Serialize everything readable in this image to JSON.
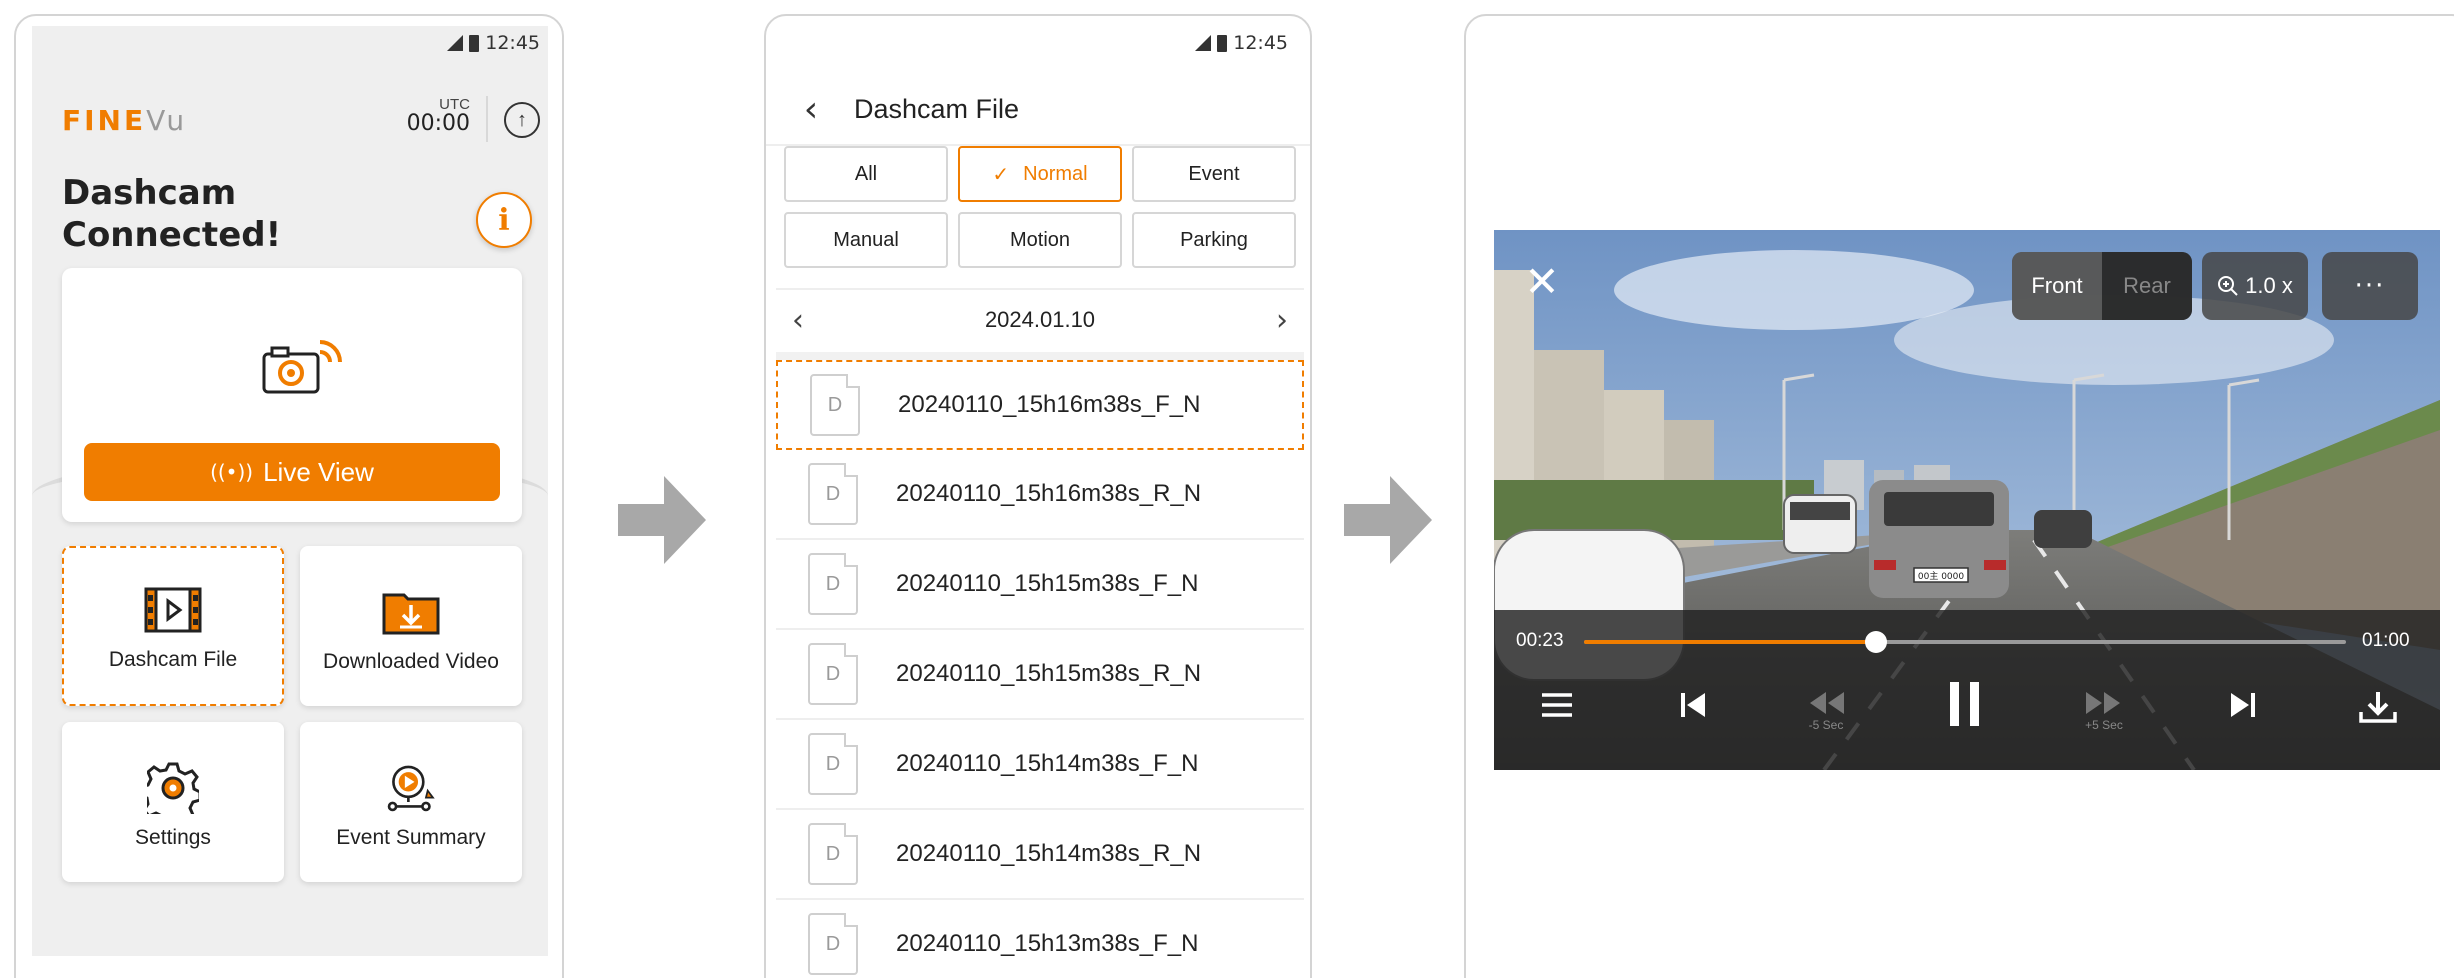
{
  "colors": {
    "accent": "#f07d00",
    "dim": "#888888"
  },
  "status": {
    "time": "12:45"
  },
  "home": {
    "logo_part1": "FINE",
    "logo_part2": "Vu",
    "utc_label": "UTC",
    "utc_time": "00:00",
    "upload_icon": "upload-circle-icon",
    "headline": "Dashcam\nConnected!",
    "info_icon": "info-icon",
    "live_view_label": "Live View",
    "tiles": [
      {
        "label": "Dashcam File",
        "icon": "film-icon",
        "selected": true
      },
      {
        "label": "Downloaded Video",
        "icon": "download-folder-icon",
        "selected": false
      },
      {
        "label": "Settings",
        "icon": "gear-icon",
        "selected": false
      },
      {
        "label": "Event Summary",
        "icon": "event-play-icon",
        "selected": false
      }
    ]
  },
  "file_screen": {
    "title": "Dashcam File",
    "filters": [
      {
        "label": "All",
        "active": false
      },
      {
        "label": "Normal",
        "active": true
      },
      {
        "label": "Event",
        "active": false
      },
      {
        "label": "Manual",
        "active": false
      },
      {
        "label": "Motion",
        "active": false
      },
      {
        "label": "Parking",
        "active": false
      }
    ],
    "date": "2024.01.10",
    "doc_letter": "D",
    "files": [
      "20240110_15h16m38s_F_N",
      "20240110_15h16m38s_R_N",
      "20240110_15h15m38s_F_N",
      "20240110_15h15m38s_R_N",
      "20240110_15h14m38s_F_N",
      "20240110_15h14m38s_R_N",
      "20240110_15h13m38s_F_N"
    ],
    "selected_index": 0
  },
  "player": {
    "front_label": "Front",
    "rear_label": "Rear",
    "zoom_label": "1.0 x",
    "more_label": "···",
    "current_time": "00:23",
    "end_time": "01:00",
    "progress": 0.383,
    "rewind_label": "-5 Sec",
    "forward_label": "+5 Sec",
    "plate_text": "00主 0000"
  }
}
